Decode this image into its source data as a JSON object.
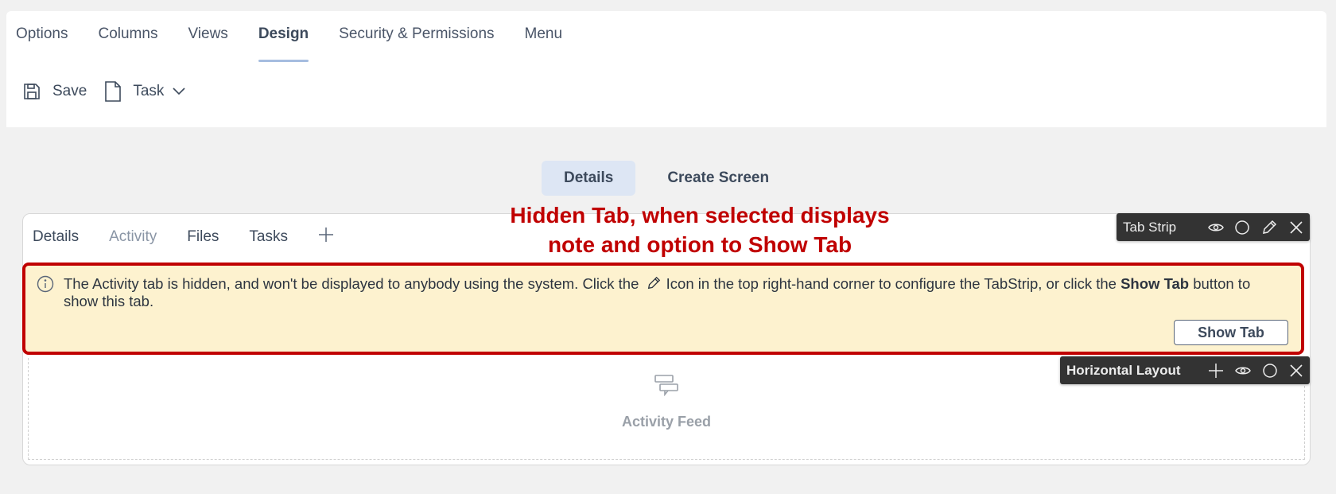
{
  "top_tabs": {
    "options": "Options",
    "columns": "Columns",
    "views": "Views",
    "design": "Design",
    "security": "Security & Permissions",
    "menu": "Menu"
  },
  "toolbar": {
    "save_label": "Save",
    "task_label": "Task"
  },
  "segmented": {
    "details": "Details",
    "create_screen": "Create Screen"
  },
  "inner_tabs": {
    "details": "Details",
    "activity": "Activity",
    "files": "Files",
    "tasks": "Tasks"
  },
  "notice": {
    "text_before": "The Activity tab is hidden, and won't be displayed to anybody using the system. Click the ",
    "text_middle": " Icon in the top right-hand corner to configure the TabStrip, or click the ",
    "bold": "Show Tab",
    "text_after": " button to show this tab.",
    "button": "Show Tab"
  },
  "tab_strip_toolbar": {
    "label": "Tab Strip"
  },
  "horizontal_layout_toolbar": {
    "label": "Horizontal Layout"
  },
  "activity_feed": {
    "label": "Activity Feed"
  },
  "annotation": {
    "line1": "Hidden Tab, when selected displays",
    "line2": "note and option to Show Tab"
  },
  "colors": {
    "accent": "#a6bde0",
    "notice_bg": "#fdf2cf",
    "annotation_red": "#c00000",
    "toolbar_dark": "#333333"
  },
  "icons": [
    "save-icon",
    "document-icon",
    "chevron-down-icon",
    "plus-icon",
    "info-icon",
    "pencil-icon",
    "eye-icon",
    "circle-icon",
    "close-icon",
    "chat-icon"
  ]
}
